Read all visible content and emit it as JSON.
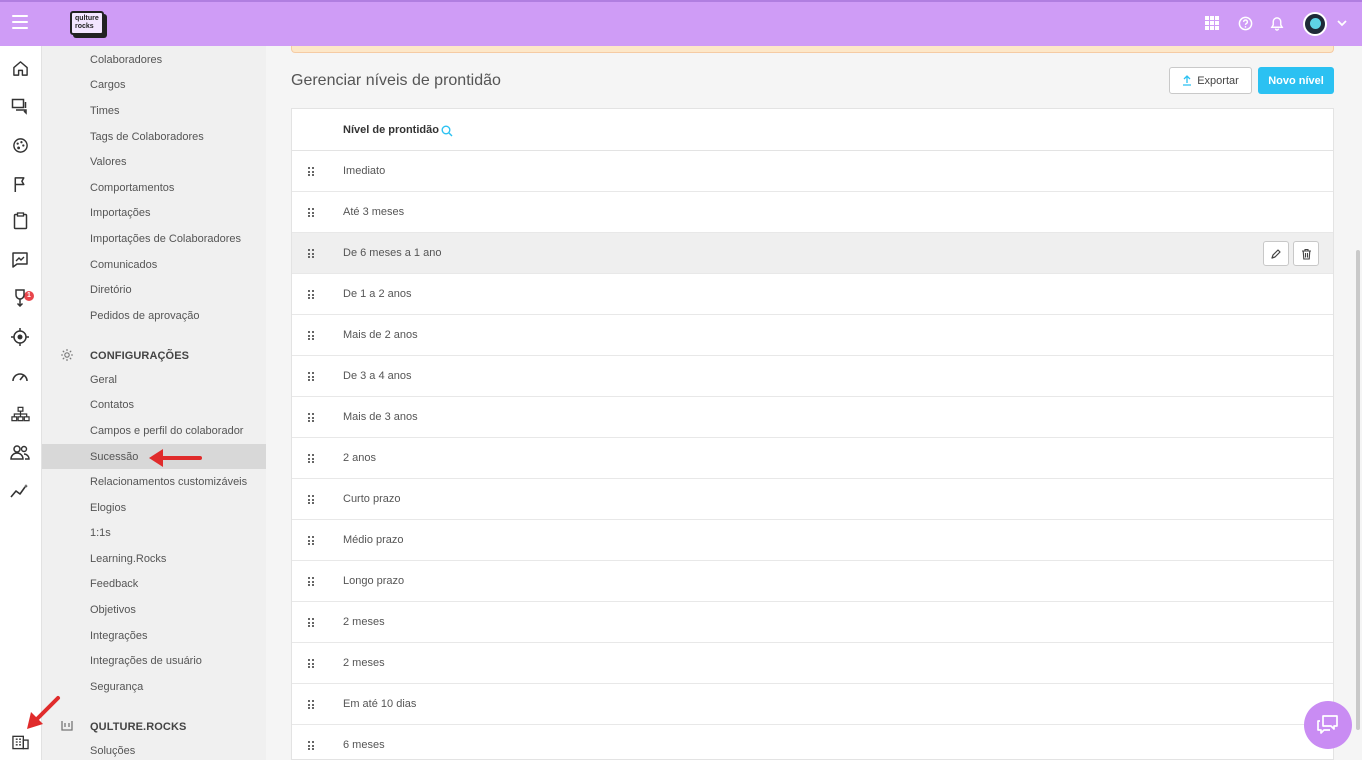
{
  "topbar": {
    "logo_text": "qulture rocks",
    "menu_icon": "hamburger-icon",
    "right_icons": [
      "apps-grid-icon",
      "help-icon",
      "bell-icon",
      "avatar",
      "chevron-down-icon"
    ]
  },
  "rail": {
    "icons": [
      "home-icon",
      "feed-icon",
      "palette-icon",
      "flag-icon",
      "clipboard-icon",
      "chart-comment-icon",
      "award-icon",
      "target-icon",
      "gauge-icon",
      "org-chart-icon",
      "people-icon",
      "analytics-icon",
      "building-icon"
    ],
    "badge": "1"
  },
  "sidebar": {
    "admin_items": [
      "Colaboradores",
      "Cargos",
      "Times",
      "Tags de Colaboradores",
      "Valores",
      "Comportamentos",
      "Importações",
      "Importações de Colaboradores",
      "Comunicados",
      "Diretório",
      "Pedidos de aprovação"
    ],
    "config_section": "CONFIGURAÇÕES",
    "config_items": [
      "Geral",
      "Contatos",
      "Campos e perfil do colaborador",
      "Sucessão",
      "Relacionamentos customizáveis",
      "Elogios",
      "1:1s",
      "Learning.Rocks",
      "Feedback",
      "Objetivos",
      "Integrações",
      "Integrações de usuário",
      "Segurança"
    ],
    "active_item": "Sucessão",
    "qr_section": "QULTURE.ROCKS",
    "qr_items": [
      "Soluções"
    ]
  },
  "main": {
    "title": "Gerenciar níveis de prontidão",
    "export_label": "Exportar",
    "new_label": "Novo nível",
    "column_header": "Nível de prontidão",
    "rows": [
      "Imediato",
      "Até 3 meses",
      "De 6 meses a 1 ano",
      "De 1 a 2 anos",
      "Mais de 2 anos",
      "De 3 a 4 anos",
      "Mais de 3 anos",
      "2 anos",
      "Curto prazo",
      "Médio prazo",
      "Longo prazo",
      "2 meses",
      "2 meses",
      "Em até 10 dias",
      "6 meses"
    ],
    "hovered_row": "De 6 meses a 1 ano",
    "row_actions": [
      "pencil-icon",
      "trash-icon"
    ]
  },
  "colors": {
    "topbar": "#cf9cf6",
    "primary_button": "#2bc1f2",
    "chat_bubble": "#c98cf3",
    "annotation_arrow": "#e02b2b"
  }
}
